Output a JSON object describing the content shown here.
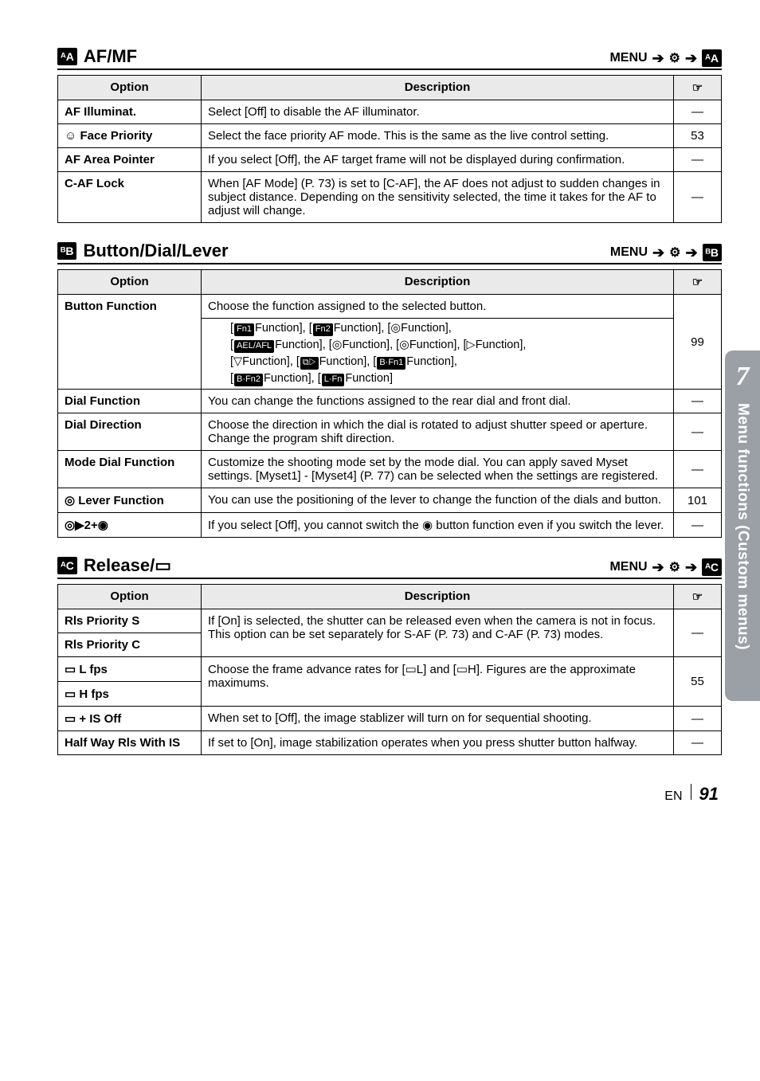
{
  "sidetab": {
    "number": "7",
    "text": "Menu functions (Custom menus)"
  },
  "footer": {
    "lang": "EN",
    "page": "91"
  },
  "menu_label": "MENU",
  "sec1": {
    "badge": "ᴬA",
    "title": "AF/MF",
    "target_badge": "ᴬA",
    "head_opt": "Option",
    "head_desc": "Description",
    "head_ref": "☞",
    "r1o": "AF Illuminat.",
    "r1d": "Select [Off] to disable the AF illuminator.",
    "r1r": "—",
    "r2o": "☺ Face Priority",
    "r2d": "Select the face priority AF mode. This is the same as the live control setting.",
    "r2r": "53",
    "r3o": "AF Area Pointer",
    "r3d": "If you select [Off], the AF target frame will not be displayed during confirmation.",
    "r3r": "—",
    "r4o": "C-AF Lock",
    "r4d": "When [AF Mode] (P. 73) is set to [C-AF], the AF does not adjust to sudden changes in subject distance. Depending on the sensitivity selected, the time it takes for the AF to adjust will change.",
    "r4r": "—"
  },
  "sec2": {
    "badge": "ᴮB",
    "title": "Button/Dial/Lever",
    "target_badge": "ᴮB",
    "head_opt": "Option",
    "head_desc": "Description",
    "head_ref": "☞",
    "r1o": "Button Function",
    "r1d": "Choose the function assigned to the selected button.",
    "r1n1": "Fn1",
    "r1t1": "Function], [",
    "r1n2": "Fn2",
    "r1t2": "Function], [◎Function],",
    "r1n3": "AEL/AFL",
    "r1t3": "Function], [◎Function], [◎Function], [▷Function],",
    "r1t4": "[▽Function], [",
    "r1n4": "⧉▷",
    "r1t4b": "Function], [",
    "r1n5": "B·Fn1",
    "r1t5": "Function],",
    "r1n6": "B·Fn2",
    "r1t6": "Function], [",
    "r1n7": "L·Fn",
    "r1t7": "Function]",
    "r1r": "99",
    "r2o": "Dial Function",
    "r2d": "You can change the functions assigned to the rear dial and front dial.",
    "r2r": "—",
    "r3o": "Dial Direction",
    "r3d": "Choose the direction in which the dial is rotated to adjust shutter speed or aperture. Change the program shift direction.",
    "r3r": "—",
    "r4o": "Mode Dial Function",
    "r4d": "Customize the shooting mode set by the mode dial. You can apply saved Myset settings. [Myset1] - [Myset4] (P. 77) can be selected when the settings are registered.",
    "r4r": "—",
    "r5o": "◎ Lever Function",
    "r5d": "You can use the positioning of the lever to change the function of the dials and button.",
    "r5r": "101",
    "r6o": "◎▶2+◉",
    "r6d": "If you select [Off], you cannot switch the ◉ button function even if you switch the lever.",
    "r6r": "—"
  },
  "sec3": {
    "badge": "ᴬC",
    "title": "Release/▭",
    "target_badge": "ᴬC",
    "head_opt": "Option",
    "head_desc": "Description",
    "head_ref": "☞",
    "r1o": "Rls Priority S",
    "r2o": "Rls Priority C",
    "r12d": "If [On] is selected, the shutter can be released even when the camera is not in focus. This option can be set separately for S-AF (P. 73) and C-AF (P. 73) modes.",
    "r12r": "—",
    "r3o": "▭ L fps",
    "r4o": "▭ H fps",
    "r34d": "Choose the frame advance rates for [▭L] and [▭H]. Figures are the approximate maximums.",
    "r34r": "55",
    "r5o": "▭ + IS Off",
    "r5d": "When set to [Off], the image stablizer will turn on for sequential shooting.",
    "r5r": "—",
    "r6o": "Half Way Rls With IS",
    "r6d": "If set to [On], image stabilization operates when you press shutter button halfway.",
    "r6r": "—"
  }
}
